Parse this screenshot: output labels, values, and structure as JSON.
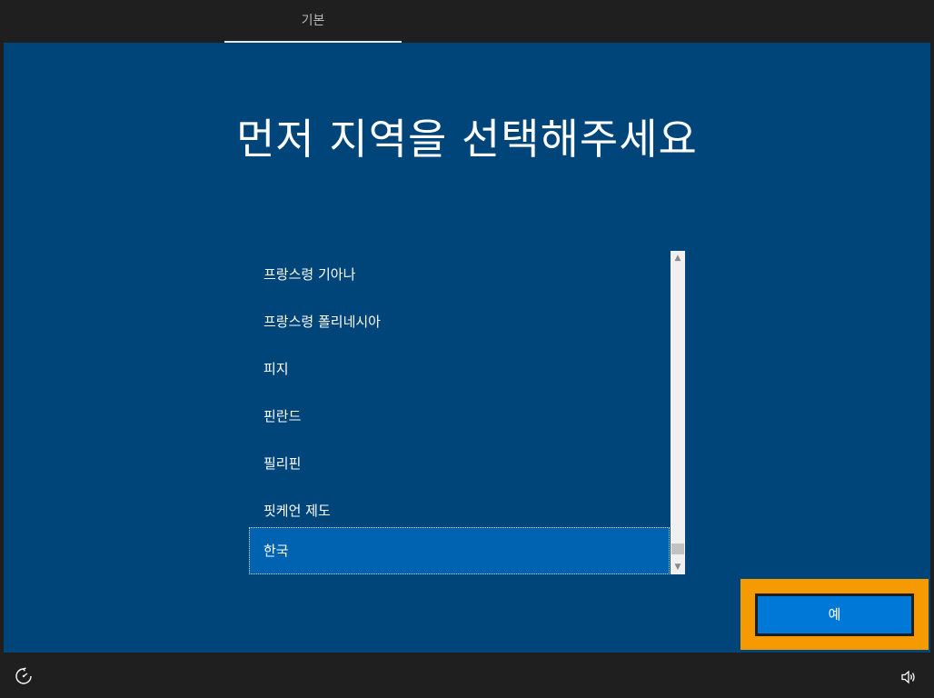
{
  "header": {
    "tab_label": "기본"
  },
  "main": {
    "title": "먼저 지역을 선택해주세요",
    "region_list": {
      "items": [
        "프랑스령 기아나",
        "프랑스령 폴리네시아",
        "피지",
        "핀란드",
        "필리핀",
        "핏케언 제도",
        "한국"
      ],
      "selected": "한국"
    }
  },
  "actions": {
    "yes_label": "예"
  },
  "footer": {
    "left_icon": "ease-of-access-icon",
    "right_icon": "volume-icon"
  },
  "colors": {
    "background": "#00457a",
    "selected_item": "#0063b1",
    "button": "#0078d7",
    "highlight": "#f59a00",
    "bars": "#1f1f1f"
  }
}
